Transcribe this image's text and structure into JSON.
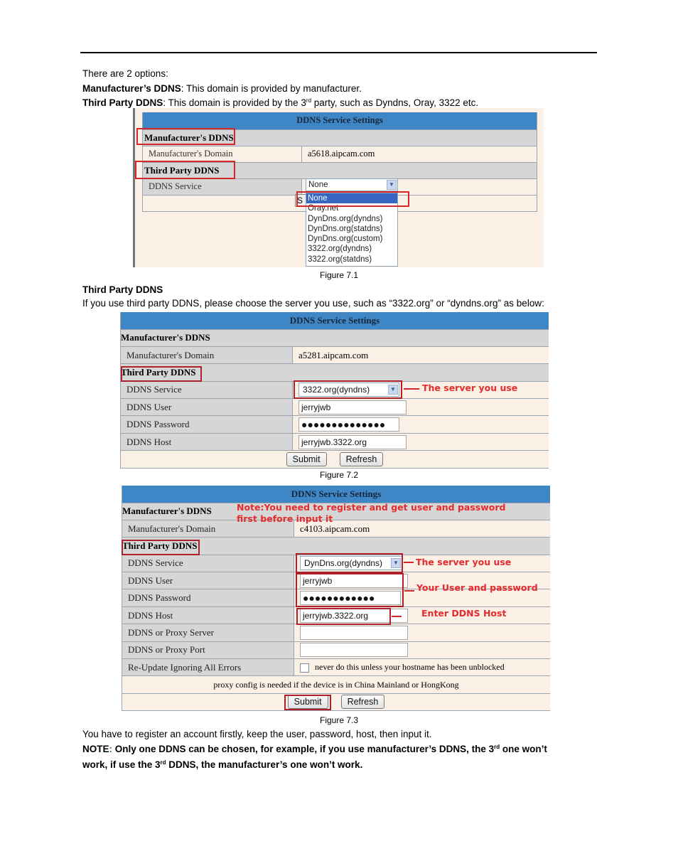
{
  "intro": {
    "line1": "There are 2 options:",
    "manufacturer_term": "Manufacturer’s DDNS",
    "manufacturer_desc": ": This domain is provided by manufacturer.",
    "third_term": "Third Party DDNS",
    "third_desc_pre": ": This domain is provided by the 3",
    "third_desc_sup": "rd",
    "third_desc_post": " party, such as Dyndns, Oray, 3322 etc."
  },
  "figure1": {
    "title": "DDNS Service Settings",
    "section_manufacturer": "Manufacturer's DDNS",
    "domain_label": "Manufacturer's Domain",
    "domain_value": "a5618.aipcam.com",
    "section_third": "Third Party DDNS",
    "service_label": "DDNS Service",
    "service_value": "None",
    "submit_partial": "S",
    "dropdown_options": [
      "None",
      "Oray.net",
      "DynDns.org(dyndns)",
      "DynDns.org(statdns)",
      "DynDns.org(custom)",
      "3322.org(dyndns)",
      "3322.org(statdns)"
    ],
    "caption": "Figure 7.1"
  },
  "section2": {
    "heading": "Third Party DDNS",
    "text": "If you use third party DDNS, please choose the server you use, such as “3322.org” or “dyndns.org” as below:"
  },
  "figure2": {
    "title": "DDNS Service Settings",
    "section_manufacturer": "Manufacturer's DDNS",
    "domain_label": "Manufacturer's Domain",
    "domain_value": "a5281.aipcam.com",
    "section_third": "Third Party DDNS",
    "service_label": "DDNS Service",
    "service_value": "3322.org(dyndns)",
    "user_label": "DDNS User",
    "user_value": "jerryjwb",
    "password_label": "DDNS Password",
    "password_value": "●●●●●●●●●●●●●●",
    "host_label": "DDNS Host",
    "host_value": "jerryjwb.3322.org",
    "submit": "Submit",
    "refresh": "Refresh",
    "annotation_server": "The server you use",
    "caption": "Figure 7.2"
  },
  "figure3": {
    "title": "DDNS Service Settings",
    "section_manufacturer": "Manufacturer's DDNS",
    "domain_label": "Manufacturer's Domain",
    "domain_value": "c4103.aipcam.com",
    "section_third": "Third Party DDNS",
    "service_label": "DDNS Service",
    "service_value": "DynDns.org(dyndns)",
    "user_label": "DDNS User",
    "user_value": "jerryjwb",
    "password_label": "DDNS Password",
    "password_value": "●●●●●●●●●●●●",
    "host_label": "DDNS Host",
    "host_value": "jerryjwb.3322.org",
    "proxy_server_label": "DDNS or Proxy Server",
    "proxy_server_value": "",
    "proxy_port_label": "DDNS or Proxy Port",
    "proxy_port_value": "",
    "reupdate_label": "Re-Update Ignoring All Errors",
    "reupdate_checked": false,
    "reupdate_hint": "never do this unless your hostname has been unblocked",
    "proxy_note": "proxy config is needed if the device is in China Mainland or HongKong",
    "submit": "Submit",
    "refresh": "Refresh",
    "annotation_note_line1": "Note:You need to register and get user and password",
    "annotation_note_line2": "first before input it",
    "annotation_server": "The server you use",
    "annotation_user_pass": "Your User and password",
    "annotation_host": "Enter DDNS Host",
    "caption": "Figure 7.3"
  },
  "outro": {
    "line1": "You have to register an account firstly, keep the user, password, host, then input it.",
    "note_label": "NOTE",
    "note_colon": ":",
    "note_text_1": " Only one DDNS can be chosen, for example, if you use manufacturer’s DDNS, the 3",
    "note_sup_1": "rd",
    "note_text_2": " one won’t",
    "note_text_3": "work, if use the 3",
    "note_sup_2": "rd",
    "note_text_4": " DDNS, the manufacturer’s one won’t work."
  },
  "colors": {
    "header_blue": "#3e86c5",
    "section_gray": "#d6d6d6",
    "value_beige": "#fbf0e6",
    "annotation_red": "#e52b2b",
    "dropdown_highlight": "#3665c2"
  }
}
